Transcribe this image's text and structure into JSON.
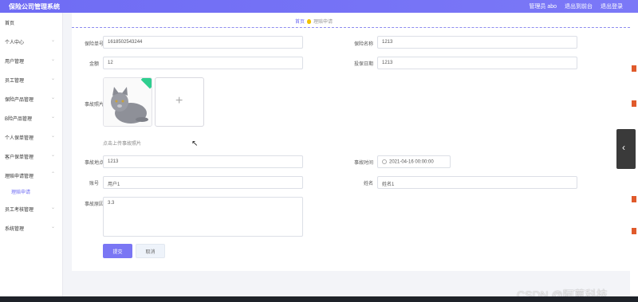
{
  "app": {
    "title": "保险公司管理系统"
  },
  "header": {
    "admin": "管理员 abo",
    "back": "退出到前台",
    "logout": "退出登录"
  },
  "sidebar": {
    "items": [
      {
        "label": "首页"
      },
      {
        "label": "个人中心"
      },
      {
        "label": "用户管理"
      },
      {
        "label": "员工管理"
      },
      {
        "label": "保险产品管理"
      },
      {
        "label": "B险产品管理"
      },
      {
        "label": "个人保单管理"
      },
      {
        "label": "客户保单管理"
      },
      {
        "label": "理赔申请管理"
      },
      {
        "label": "理赔申请"
      },
      {
        "label": "员工考核管理"
      },
      {
        "label": "系统管理"
      }
    ]
  },
  "breadcrumb": {
    "home": "首页",
    "current": "理赔申请"
  },
  "form": {
    "policy_no_label": "保险单号",
    "policy_no_value": "1618502543244",
    "insurance_name_label": "保险名称",
    "insurance_name_value": "1213",
    "amount_label": "金额",
    "amount_value": "12",
    "insure_date_label": "投保日期",
    "insure_date_value": "1213",
    "photo_label": "事故照片",
    "upload_hint": "点击上传事故照片",
    "location_label": "事故地点",
    "location_value": "1213",
    "time_label": "事故时间",
    "time_value": "2021-04-16 00:00:00",
    "account_label": "账号",
    "account_value": "用户1",
    "name_label": "姓名",
    "name_value": "姓名1",
    "reason_label": "事故原因",
    "reason_value": "3.3",
    "submit": "提交",
    "cancel": "取消"
  },
  "watermark": "CSDN @阿莫科技",
  "colors": {
    "accent": "#7a76f4",
    "success_badge": "#2fce8f"
  }
}
